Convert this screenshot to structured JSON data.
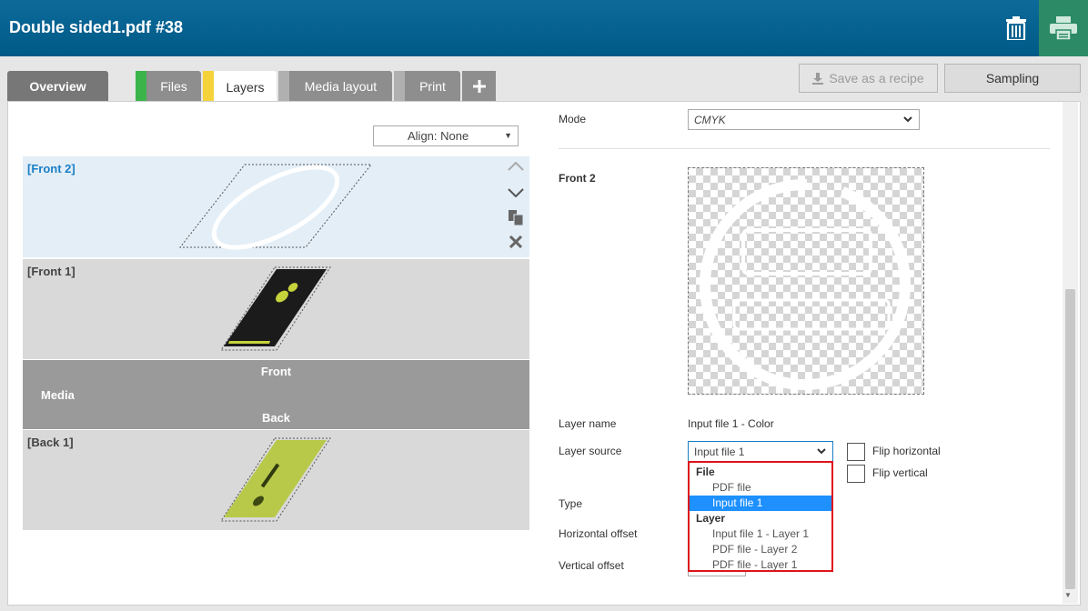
{
  "header": {
    "title": "Double sided1.pdf #38"
  },
  "tabs": [
    {
      "label": "Overview"
    },
    {
      "label": "Files",
      "color": "#3bb54a"
    },
    {
      "label": "Layers",
      "color": "#f5d23a"
    },
    {
      "label": "Media layout",
      "color": "#b0b0b0"
    },
    {
      "label": "Print",
      "color": "#b0b0b0"
    }
  ],
  "toolbar": {
    "save_recipe_label": "Save as a recipe",
    "sampling_label": "Sampling"
  },
  "left_panel": {
    "align_value": "Align: None",
    "layers": [
      {
        "name": "[Front 2]",
        "selected": true
      },
      {
        "name": "[Front 1]"
      },
      {
        "name": "[Back 1]"
      }
    ],
    "media": {
      "front_label": "Front",
      "media_label": "Media",
      "back_label": "Back"
    }
  },
  "form": {
    "mode_label": "Mode",
    "mode_value": "CMYK",
    "section_title": "Front 2",
    "layer_name_label": "Layer name",
    "layer_name_value": "Input file 1 - Color",
    "layer_source_label": "Layer source",
    "layer_source_value": "Input file 1",
    "flip_horizontal_label": "Flip horizontal",
    "flip_vertical_label": "Flip vertical",
    "type_label": "Type",
    "horizontal_offset_label": "Horizontal offset",
    "vertical_offset_label": "Vertical offset"
  },
  "dropdown": {
    "groups": [
      {
        "label": "File",
        "options": [
          "PDF file",
          "Input file 1"
        ]
      },
      {
        "label": "Layer",
        "options": [
          "Input file 1 - Layer 1",
          "PDF file - Layer 2",
          "PDF file - Layer 1"
        ]
      }
    ],
    "selected": "Input file 1"
  },
  "colors": {
    "header": "#005a87",
    "print_button": "#2c8a66",
    "selected_layer_text": "#1a7fc4",
    "highlight_border": "#e0131b",
    "selected_option": "#1e90ff"
  }
}
